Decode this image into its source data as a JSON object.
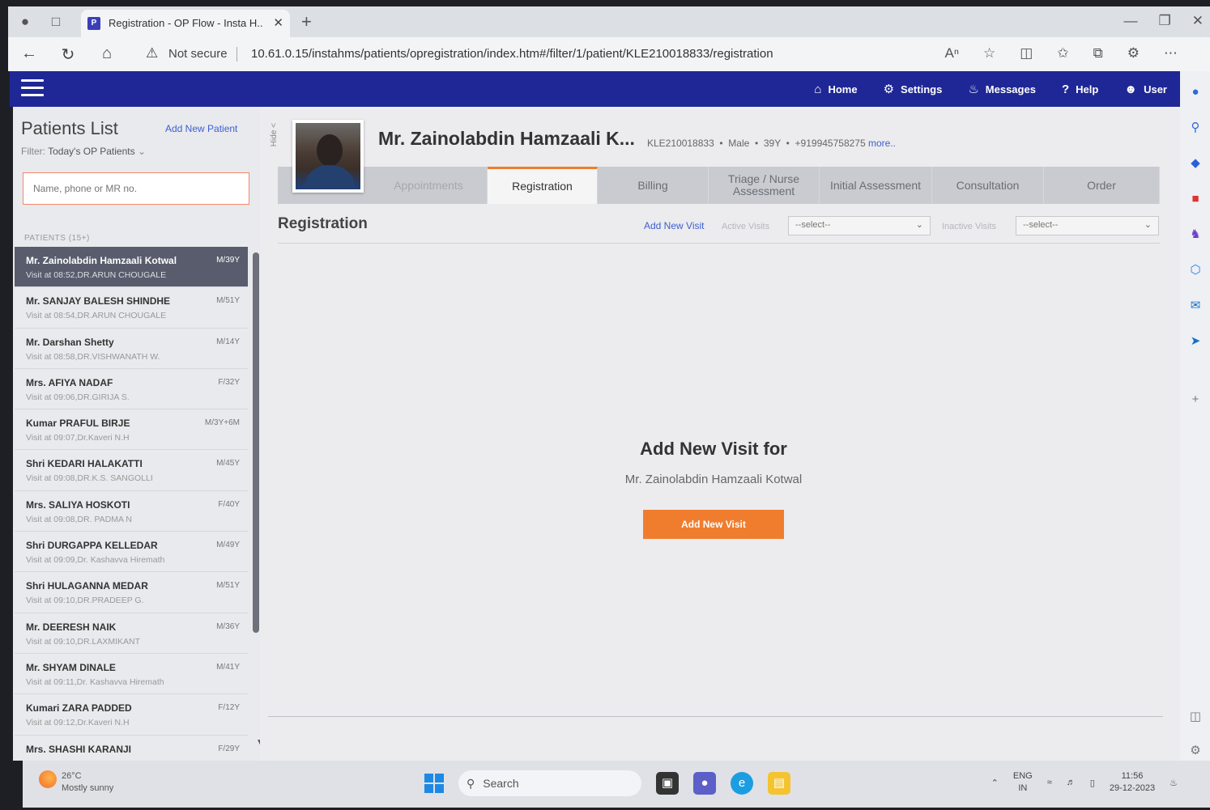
{
  "browser": {
    "tab_title": "Registration - OP Flow - Insta H...",
    "favicon_letter": "P",
    "security_label": "Not secure",
    "url": "10.61.0.15/instahms/patients/opregistration/index.htm#/filter/1/patient/KLE210018833/registration"
  },
  "app_nav": {
    "items": [
      {
        "label": "Home",
        "icon": "home-icon"
      },
      {
        "label": "Settings",
        "icon": "gear-icon"
      },
      {
        "label": "Messages",
        "icon": "bell-icon"
      },
      {
        "label": "Help",
        "icon": "help-icon"
      },
      {
        "label": "User",
        "icon": "user-icon"
      }
    ]
  },
  "sidebar": {
    "title": "Patients List",
    "add_new_patient": "Add New Patient",
    "filter_label": "Filter:",
    "filter_value": "Today's OP Patients",
    "search_placeholder": "Name, phone or MR no.",
    "count_label": "PATIENTS (15+)",
    "patients": [
      {
        "name": "Mr. Zainolabdin Hamzaali Kotwal",
        "age": "M/39Y",
        "visit": "Visit at 08:52,DR.ARUN CHOUGALE",
        "active": true
      },
      {
        "name": "Mr. SANJAY BALESH SHINDHE",
        "age": "M/51Y",
        "visit": "Visit at 08:54,DR.ARUN CHOUGALE"
      },
      {
        "name": "Mr. Darshan Shetty",
        "age": "M/14Y",
        "visit": "Visit at 08:58,DR.VISHWANATH W."
      },
      {
        "name": "Mrs. AFIYA NADAF",
        "age": "F/32Y",
        "visit": "Visit at 09:06,DR.GIRIJA S."
      },
      {
        "name": "Kumar PRAFUL BIRJE",
        "age": "M/3Y+6M",
        "visit": "Visit at 09:07,Dr.Kaveri N.H"
      },
      {
        "name": "Shri KEDARI HALAKATTI",
        "age": "M/45Y",
        "visit": "Visit at 09:08,DR.K.S. SANGOLLI"
      },
      {
        "name": "Mrs. SALIYA HOSKOTI",
        "age": "F/40Y",
        "visit": "Visit at 09:08,DR. PADMA N"
      },
      {
        "name": "Shri DURGAPPA KELLEDAR",
        "age": "M/49Y",
        "visit": "Visit at 09:09,Dr. Kashavva Hiremath"
      },
      {
        "name": "Shri HULAGANNA MEDAR",
        "age": "M/51Y",
        "visit": "Visit at 09:10,DR.PRADEEP G."
      },
      {
        "name": "Mr. DEERESH NAIK",
        "age": "M/36Y",
        "visit": "Visit at 09:10,DR.LAXMIKANT"
      },
      {
        "name": "Mr. SHYAM DINALE",
        "age": "M/41Y",
        "visit": "Visit at 09:11,Dr. Kashavva Hiremath"
      },
      {
        "name": "Kumari ZARA PADDED",
        "age": "F/12Y",
        "visit": "Visit at 09:12,Dr.Kaveri N.H"
      },
      {
        "name": "Mrs. SHASHI KARANJI",
        "age": "F/29Y",
        "visit": ""
      }
    ]
  },
  "patient": {
    "hide_label": "Hide <",
    "name": "Mr. Zainolabdin Hamzaali K...",
    "mr_no": "KLE210018833",
    "gender": "Male",
    "age": "39Y",
    "phone": "+919945758275",
    "more": "more..",
    "dot": "•"
  },
  "tabs": [
    {
      "label": "Appointments",
      "state": "dim"
    },
    {
      "label": "Registration",
      "state": "active"
    },
    {
      "label": "Billing",
      "state": "normal"
    },
    {
      "label": "Triage / Nurse Assessment",
      "state": "normal"
    },
    {
      "label": "Initial Assessment",
      "state": "normal"
    },
    {
      "label": "Consultation",
      "state": "normal"
    },
    {
      "label": "Order",
      "state": "normal"
    }
  ],
  "registration": {
    "section_title": "Registration",
    "add_new_visit_link": "Add New Visit",
    "active_visits_label": "Active Visits",
    "active_visits_value": "--select--",
    "inactive_visits_label": "Inactive Visits",
    "inactive_visits_value": "--select--",
    "empty_heading": "Add New Visit for",
    "empty_patient": "Mr. Zainolabdin Hamzaali Kotwal",
    "add_visit_button": "Add New Visit"
  },
  "taskbar": {
    "temperature": "26°C",
    "weather": "Mostly sunny",
    "search_label": "Search",
    "lang_1": "ENG",
    "lang_2": "IN",
    "time": "11:56",
    "date": "29-12-2023"
  },
  "colors": {
    "app_header": "#1f2796",
    "accent": "#f07d2e",
    "link": "#3d5fcf",
    "active_row": "#585c6c"
  }
}
